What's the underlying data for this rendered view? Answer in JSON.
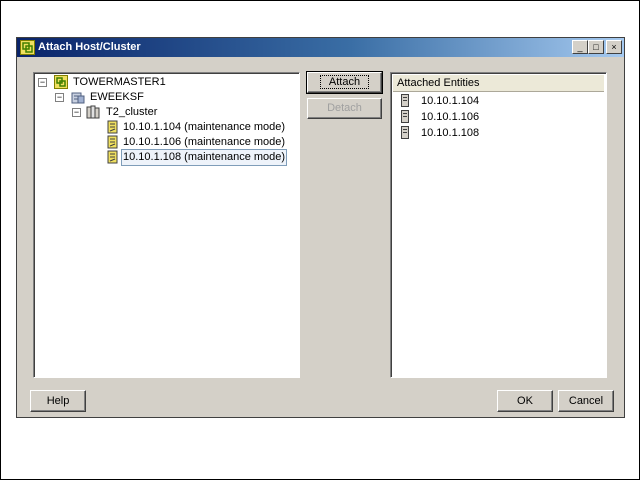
{
  "window": {
    "title": "Attach Host/Cluster",
    "controls": [
      "_",
      "□",
      "×"
    ]
  },
  "tree": {
    "root": {
      "label": "TOWERMASTER1",
      "icon": "vcenter-icon"
    },
    "datacenter": {
      "label": "EWEEKSF",
      "icon": "datacenter-icon"
    },
    "cluster": {
      "label": "T2_cluster",
      "icon": "cluster-icon"
    },
    "hosts": [
      {
        "label": "10.10.1.104 (maintenance mode)"
      },
      {
        "label": "10.10.1.106 (maintenance mode)"
      },
      {
        "label": "10.10.1.108 (maintenance mode)"
      }
    ]
  },
  "buttons": {
    "attach": "Attach",
    "detach": "Detach",
    "help": "Help",
    "ok": "OK",
    "cancel": "Cancel"
  },
  "attached": {
    "header": "Attached Entities",
    "items": [
      "10.10.1.104",
      "10.10.1.106",
      "10.10.1.108"
    ]
  },
  "colors": {
    "titlebar_start": "#0a246a",
    "titlebar_end": "#a6caf0",
    "dialog_bg": "#d4d0c8"
  }
}
